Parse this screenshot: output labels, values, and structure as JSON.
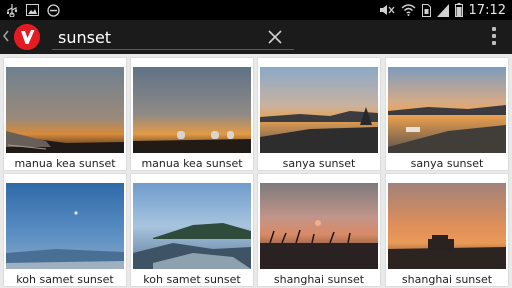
{
  "statusbar": {
    "time": "17:12",
    "left_icons": [
      "usb-icon",
      "image-icon",
      "do-not-disturb-icon"
    ],
    "right_icons": [
      "mute-icon",
      "wifi-icon",
      "sim-icon",
      "signal-icon",
      "battery-icon"
    ]
  },
  "actionbar": {
    "search_value": "sunset",
    "logo_letter": "V",
    "icons": [
      "back-chevron-icon",
      "app-logo-icon",
      "clear-icon",
      "overflow-menu-icon"
    ]
  },
  "results": [
    {
      "caption": "manua kea sunset"
    },
    {
      "caption": "manua kea sunset"
    },
    {
      "caption": "sanya sunset"
    },
    {
      "caption": "sanya sunset"
    },
    {
      "caption": "koh samet sunset"
    },
    {
      "caption": "koh samet sunset"
    },
    {
      "caption": "shanghai sunset"
    },
    {
      "caption": "shanghai sunset"
    }
  ]
}
